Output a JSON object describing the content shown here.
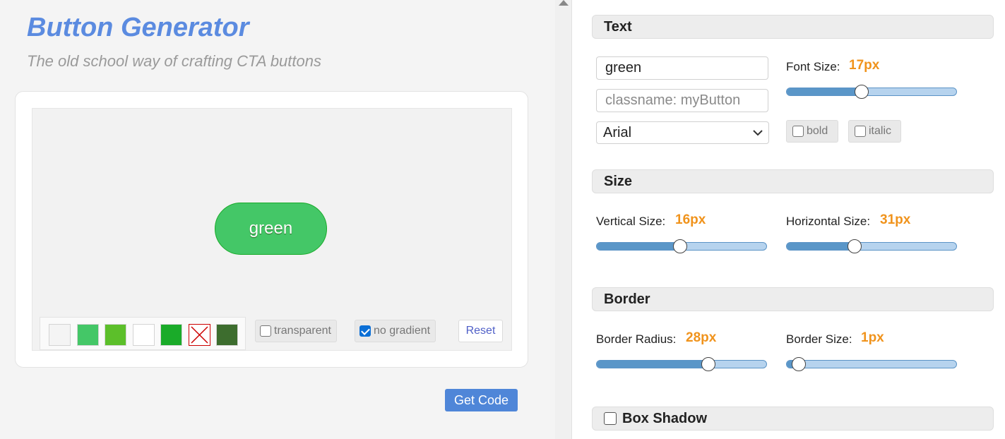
{
  "header": {
    "title": "Button Generator",
    "subtitle": "The old school way of crafting CTA buttons"
  },
  "preview": {
    "button_text": "green",
    "button_color": "#44c767",
    "button_border_color": "#18ab29"
  },
  "swatches": [
    {
      "name": "light-gray",
      "color": "#f4f4f4"
    },
    {
      "name": "light-green",
      "color": "#44c767"
    },
    {
      "name": "lime-green",
      "color": "#5cbf2a"
    },
    {
      "name": "white",
      "color": "#ffffff"
    },
    {
      "name": "green",
      "color": "#1aab29"
    },
    {
      "name": "none",
      "color": "none"
    },
    {
      "name": "dark-green",
      "color": "#3d6d2e"
    }
  ],
  "options": {
    "transparent_label": "transparent",
    "transparent_checked": false,
    "no_gradient_label": "no gradient",
    "no_gradient_checked": true,
    "reset_label": "Reset"
  },
  "get_code_label": "Get Code",
  "sections": {
    "text": {
      "title": "Text",
      "text_value": "green",
      "classname_placeholder": "classname: myButton",
      "font_value": "Arial",
      "font_size_label": "Font Size:",
      "font_size_value": "17px",
      "font_size_fraction": 0.44,
      "bold_label": "bold",
      "italic_label": "italic"
    },
    "size": {
      "title": "Size",
      "vertical_label": "Vertical Size:",
      "vertical_value": "16px",
      "vertical_fraction": 0.49,
      "horizontal_label": "Horizontal Size:",
      "horizontal_value": "31px",
      "horizontal_fraction": 0.4
    },
    "border": {
      "title": "Border",
      "radius_label": "Border Radius:",
      "radius_value": "28px",
      "radius_fraction": 0.66,
      "size_label": "Border Size:",
      "size_value": "1px",
      "size_fraction": 0.07
    },
    "box_shadow": {
      "title": "Box Shadow",
      "checked": false
    }
  },
  "colors": {
    "accent_title": "#5b8be0",
    "value_orange": "#f0931c",
    "slider_fill": "#5a96c8"
  }
}
